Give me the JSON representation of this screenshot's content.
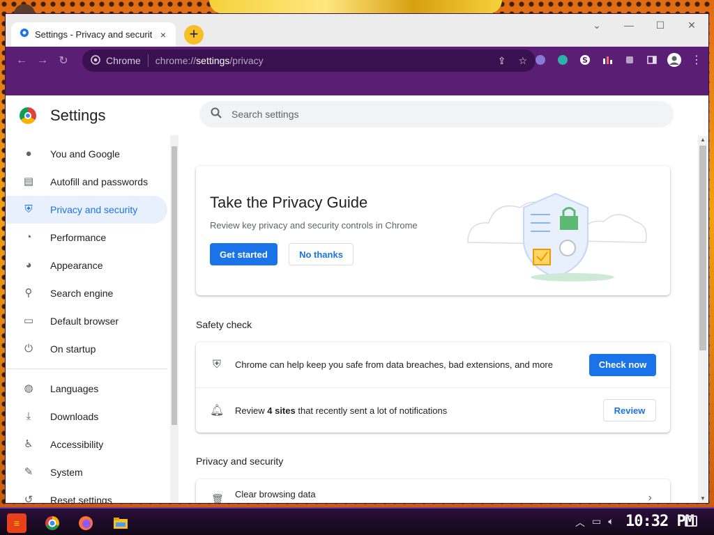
{
  "browser": {
    "tab_title": "Settings - Privacy and security",
    "tab_close": "×",
    "new_tab": "+",
    "omnibox": {
      "site_label": "Chrome",
      "url_scheme": "chrome://",
      "url_host": "settings",
      "url_path": "/privacy"
    },
    "extensions": [
      "shield-extension",
      "tracker-extension",
      "s-extension",
      "stats-extension",
      "puzzle-extension",
      "sidebar-toggle",
      "profile"
    ]
  },
  "sidebar": {
    "title": "Settings",
    "items": [
      {
        "label": "You and Google",
        "icon": "person-icon",
        "active": false
      },
      {
        "label": "Autofill and passwords",
        "icon": "clipboard-icon",
        "active": false
      },
      {
        "label": "Privacy and security",
        "icon": "shield-icon",
        "active": true
      },
      {
        "label": "Performance",
        "icon": "gauge-icon",
        "active": false
      },
      {
        "label": "Appearance",
        "icon": "palette-icon",
        "active": false
      },
      {
        "label": "Search engine",
        "icon": "search-icon",
        "active": false
      },
      {
        "label": "Default browser",
        "icon": "browser-icon",
        "active": false
      },
      {
        "label": "On startup",
        "icon": "power-icon",
        "active": false
      },
      {
        "label": "Languages",
        "icon": "globe-icon",
        "active": false
      },
      {
        "label": "Downloads",
        "icon": "download-icon",
        "active": false
      },
      {
        "label": "Accessibility",
        "icon": "accessibility-icon",
        "active": false
      },
      {
        "label": "System",
        "icon": "wrench-icon",
        "active": false
      },
      {
        "label": "Reset settings",
        "icon": "reset-icon",
        "active": false
      }
    ]
  },
  "search": {
    "placeholder": "Search settings"
  },
  "privacy_guide": {
    "title": "Take the Privacy Guide",
    "subtitle": "Review key privacy and security controls in Chrome",
    "primary_button": "Get started",
    "secondary_button": "No thanks"
  },
  "safety_check": {
    "heading": "Safety check",
    "row1_text": "Chrome can help keep you safe from data breaches, bad extensions, and more",
    "row1_button": "Check now",
    "row2_prefix": "Review ",
    "row2_count": "4 sites",
    "row2_suffix": " that recently sent a lot of notifications",
    "row2_button": "Review"
  },
  "privacy_section": {
    "heading": "Privacy and security",
    "clear_label": "Clear browsing data"
  },
  "taskbar": {
    "clock": "10:32 PM"
  },
  "colors": {
    "accent": "#1a73e8",
    "toolbar": "#5a1e75",
    "active_nav_bg": "#e8f0fe"
  }
}
